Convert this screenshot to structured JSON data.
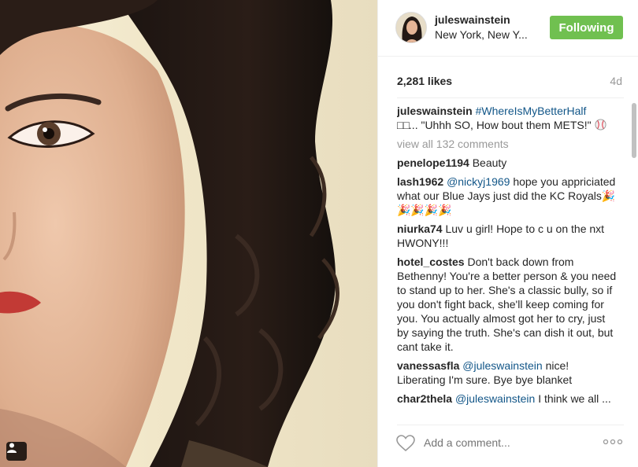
{
  "post": {
    "username": "juleswainstein",
    "location": "New York, New Y...",
    "follow_label": "Following",
    "likes": "2,281 likes",
    "age": "4d",
    "add_comment_placeholder": "Add a comment..."
  },
  "caption": {
    "user": "juleswainstein",
    "hashtag": "#WhereIsMyBetterHalf",
    "boxes": "□□",
    "text": "... \"Uhhh SO, How bout them METS!\""
  },
  "view_all": "view all 132 comments",
  "comments": [
    {
      "user": "penelope1194",
      "mention": "",
      "text": "Beauty"
    },
    {
      "user": "lash1962",
      "mention": "@nickyj1969",
      "text": "hope you appriciated what our Blue Jays just did the KC Royals🎉🎉🎉🎉🎉"
    },
    {
      "user": "niurka74",
      "mention": "",
      "text": "Luv u girl! Hope to c u on the nxt HWONY!!!"
    },
    {
      "user": "hotel_costes",
      "mention": "",
      "text": "Don't back down from Bethenny! You're a better person & you need to stand up to her. She's a classic bully, so if you don't fight back, she'll keep coming for you. You actually almost got her to cry, just by saying the truth. She's can dish it out, but cant take it."
    },
    {
      "user": "vanessasfla",
      "mention": "@juleswainstein",
      "text": "nice! Liberating I'm sure. Bye bye blanket"
    },
    {
      "user": "char2thela",
      "mention": "@juleswainstein",
      "text": "I think we all ..."
    }
  ],
  "colors": {
    "follow_button": "#70c050",
    "link": "#125688",
    "muted": "#999999",
    "username": "#262626"
  },
  "icons": [
    "tag-user-icon",
    "heart-icon",
    "more-options-icon",
    "baseball-icon"
  ]
}
